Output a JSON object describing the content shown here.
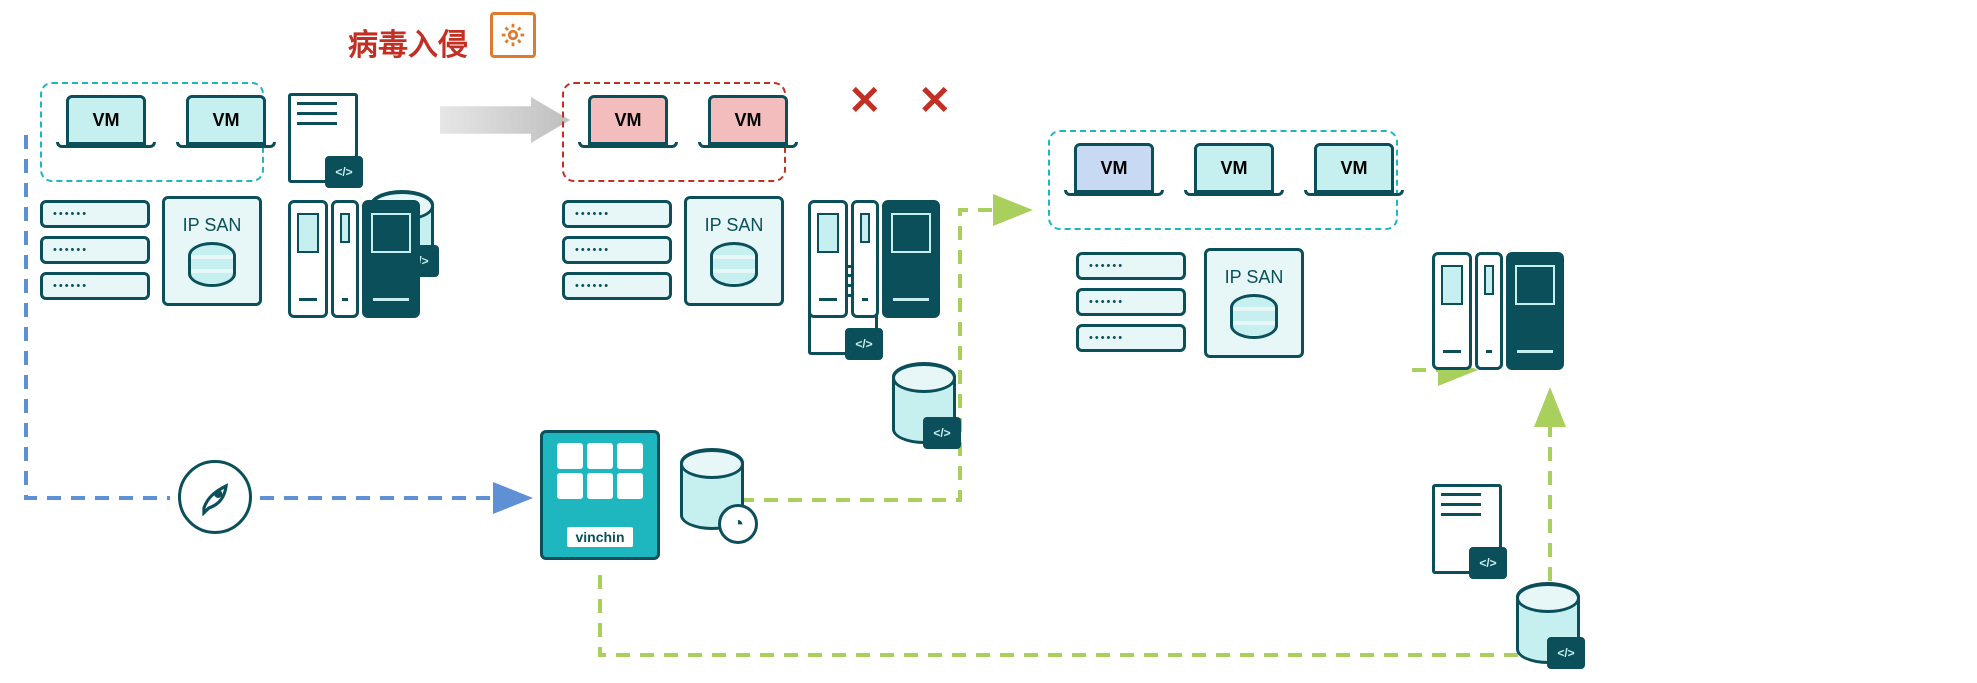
{
  "virus_label": "病毒入侵",
  "vm_label": "VM",
  "ipsan_label": "IP SAN",
  "vinchin_label": "vinchin",
  "colors": {
    "teal": "#0b4f5a",
    "accent": "#1fb7bf",
    "danger": "#c23025",
    "blue_dash": "#5f8fd4",
    "green_dash": "#a9cf5c",
    "orange": "#e07b2e"
  }
}
